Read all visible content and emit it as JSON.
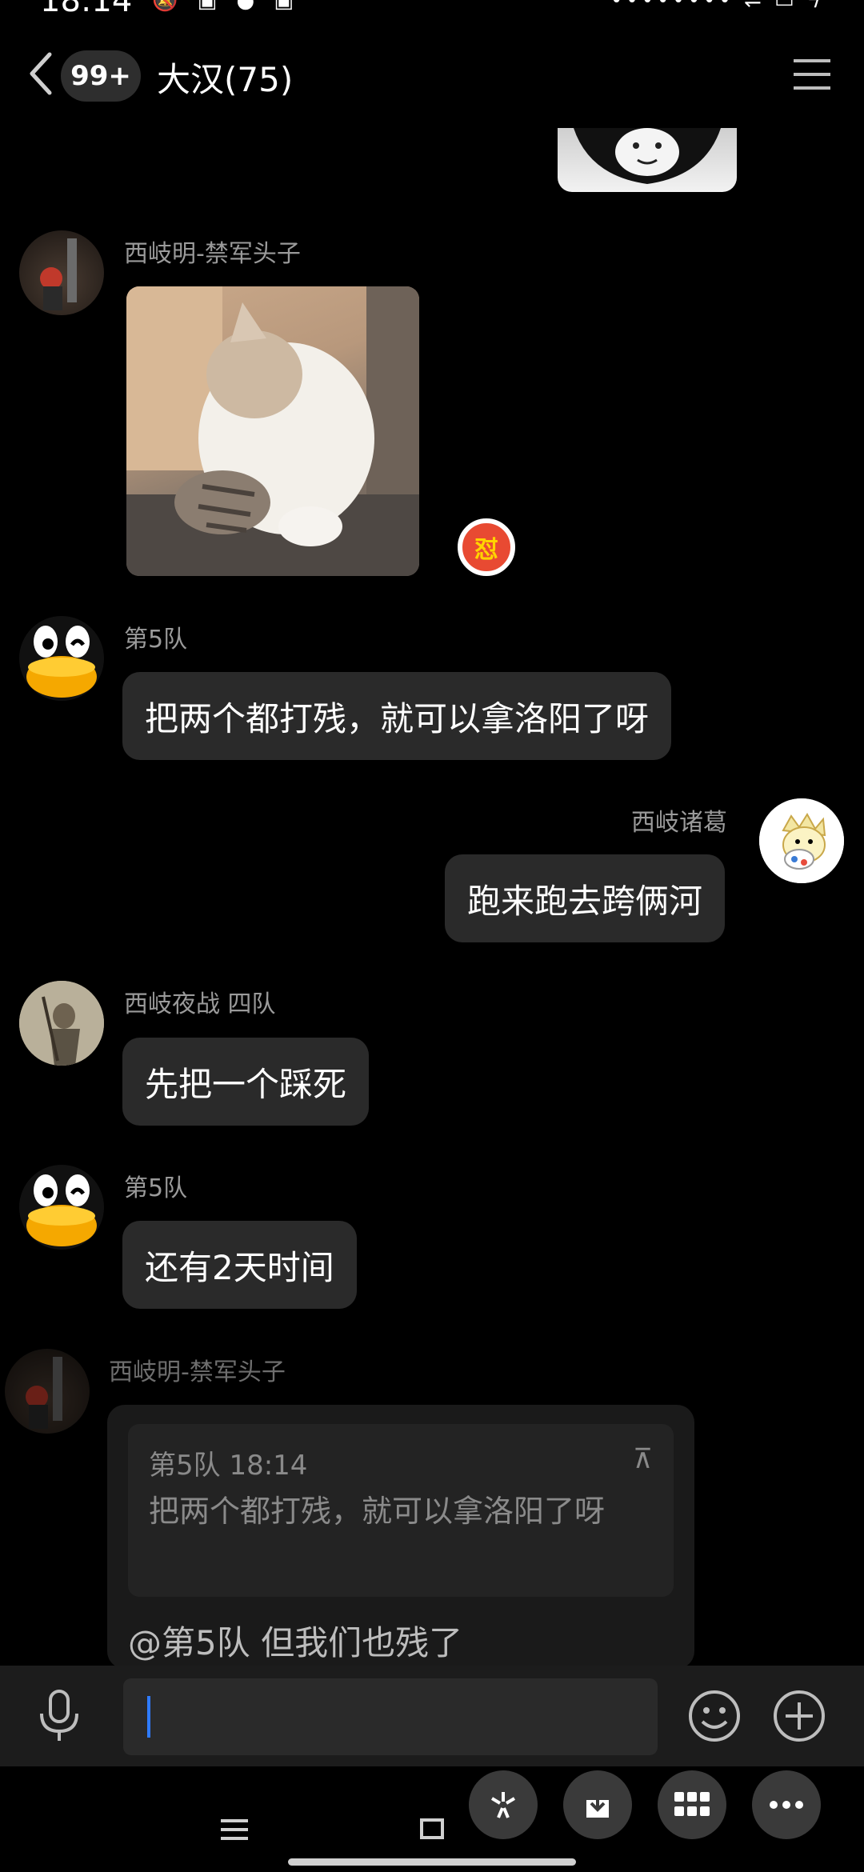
{
  "status_bar": {
    "time": "18:14",
    "right_glyphs": "•••••••• ⇌ ▭ ϟ"
  },
  "header": {
    "unread_count": "99+",
    "title": "大汉(75)"
  },
  "messages": [
    {
      "sender": "西岐明-禁军头子",
      "type": "image",
      "reaction": "怼"
    },
    {
      "sender": "第5队",
      "text": "把两个都打残，就可以拿洛阳了呀"
    },
    {
      "sender": "西岐诸葛",
      "text": "跑来跑去跨俩河",
      "self": true
    },
    {
      "sender": "西岐夜战 四队",
      "text": "先把一个踩死"
    },
    {
      "sender": "第5队",
      "text": "还有2天时间"
    },
    {
      "sender": "西岐明-禁军头子",
      "quote": {
        "meta": "第5队 18:14",
        "text": "把两个都打残，就可以拿洛阳了呀",
        "jump_glyph": "⊼"
      },
      "text": "@第5队  但我们也残了"
    }
  ],
  "input": {
    "value": "",
    "placeholder": ""
  },
  "colors": {
    "background": "#000000",
    "bubble": "#2a2a2a",
    "caret": "#2f7bff",
    "secondary_text": "#9a9a9a"
  },
  "icons": [
    "back-icon",
    "menu-icon",
    "voice-icon",
    "emoji-icon",
    "plus-icon",
    "nav-menu-icon",
    "nav-home-icon",
    "sparkle-icon",
    "download-icon",
    "grid-icon",
    "more-icon"
  ]
}
